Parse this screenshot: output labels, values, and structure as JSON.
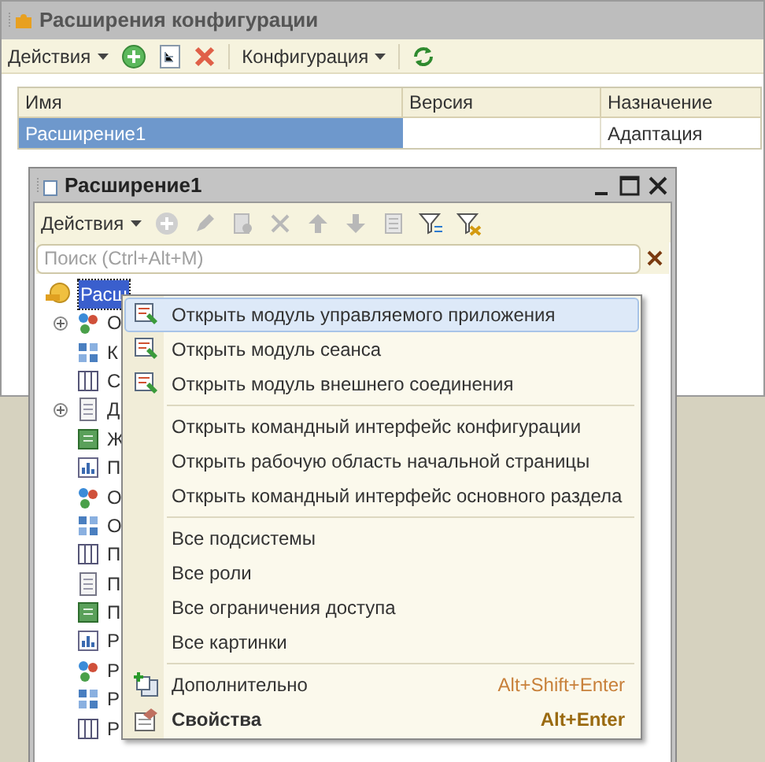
{
  "main_window": {
    "title": "Расширения конфигурации",
    "toolbar": {
      "actions_menu": "Действия",
      "config_menu": "Конфигурация"
    },
    "table": {
      "columns": [
        "Имя",
        "Версия",
        "Назначение"
      ],
      "rows": [
        {
          "name": "Расширение1",
          "purpose": "Адаптация",
          "selected": true
        }
      ]
    }
  },
  "extension_window": {
    "title": "Расширение1",
    "toolbar": {
      "actions_menu": "Действия",
      "buttons": [
        {
          "disabled": true
        },
        {
          "disabled": true
        },
        {
          "disabled": true
        },
        {
          "disabled": true
        },
        {
          "disabled": true
        },
        {
          "disabled": true
        },
        {
          "disabled": true
        },
        {
          "disabled": false
        },
        {
          "disabled": false
        }
      ]
    },
    "search": {
      "placeholder": "Поиск (Ctrl+Alt+M)"
    },
    "tree": {
      "label": "Расш",
      "selected": true,
      "children": [
        {
          "label": "О",
          "expandable": true
        },
        {
          "label": "К",
          "expandable": false
        },
        {
          "label": "С",
          "expandable": false
        },
        {
          "label": "Д",
          "expandable": true
        },
        {
          "label": "Ж",
          "expandable": false
        },
        {
          "label": "П",
          "expandable": false
        },
        {
          "label": "О",
          "expandable": false
        },
        {
          "label": "О",
          "expandable": false
        },
        {
          "label": "П",
          "expandable": false
        },
        {
          "label": "П",
          "expandable": false
        },
        {
          "label": "П",
          "expandable": false
        },
        {
          "label": "Р",
          "expandable": false
        },
        {
          "label": "Р",
          "expandable": false
        },
        {
          "label": "Р",
          "expandable": false
        },
        {
          "label": "Р",
          "expandable": false
        }
      ]
    }
  },
  "context_menu": [
    {
      "kind": "item",
      "label": "Открыть модуль управляемого приложения",
      "selected": true,
      "bold": false
    },
    {
      "kind": "item",
      "label": "Открыть модуль сеанса",
      "selected": false,
      "bold": false
    },
    {
      "kind": "item",
      "label": "Открыть модуль внешнего соединения",
      "selected": false,
      "bold": false
    },
    {
      "kind": "separator"
    },
    {
      "kind": "item",
      "label": "Открыть командный интерфейс конфигурации",
      "selected": false,
      "bold": false
    },
    {
      "kind": "item",
      "label": "Открыть рабочую область начальной страницы",
      "selected": false,
      "bold": false
    },
    {
      "kind": "item",
      "label": "Открыть командный интерфейс основного раздела",
      "selected": false,
      "bold": false
    },
    {
      "kind": "separator"
    },
    {
      "kind": "item",
      "label": "Все подсистемы",
      "selected": false,
      "bold": false
    },
    {
      "kind": "item",
      "label": "Все роли",
      "selected": false,
      "bold": false
    },
    {
      "kind": "item",
      "label": "Все ограничения доступа",
      "selected": false,
      "bold": false
    },
    {
      "kind": "item",
      "label": "Все картинки",
      "selected": false,
      "bold": false
    },
    {
      "kind": "separator"
    },
    {
      "kind": "item",
      "label": "Дополнительно",
      "shortcut": "Alt+Shift+Enter",
      "selected": false,
      "bold": false
    },
    {
      "kind": "item",
      "label": "Свойства",
      "shortcut": "Alt+Enter",
      "selected": false,
      "bold": true
    }
  ]
}
